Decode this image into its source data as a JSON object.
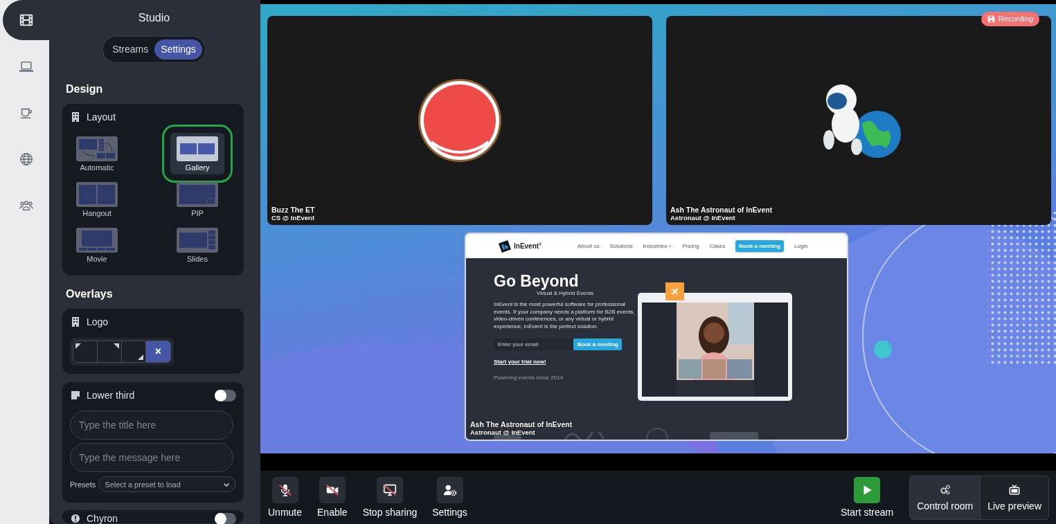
{
  "rail": {
    "items": [
      {
        "kind": "film",
        "selected": true
      },
      {
        "kind": "laptop",
        "selected": false
      },
      {
        "kind": "cup",
        "selected": false
      },
      {
        "kind": "globe",
        "selected": false
      },
      {
        "kind": "people",
        "selected": false
      }
    ]
  },
  "panel": {
    "title": "Studio",
    "tabs": [
      {
        "label": "Streams",
        "selected": false
      },
      {
        "label": "Settings",
        "selected": true
      }
    ],
    "design": {
      "heading": "Design",
      "layout": {
        "title": "Layout",
        "options": [
          {
            "kind": "automatic",
            "label": "Automatic",
            "selected": false
          },
          {
            "kind": "gallery",
            "label": "Gallery",
            "selected": true
          },
          {
            "kind": "hangout",
            "label": "Hangout",
            "selected": false
          },
          {
            "kind": "pip",
            "label": "PIP",
            "selected": false
          },
          {
            "kind": "movie",
            "label": "Movie",
            "selected": false
          },
          {
            "kind": "slides",
            "label": "Slides",
            "selected": false
          }
        ]
      }
    },
    "overlays": {
      "heading": "Overlays",
      "logo": {
        "title": "Logo",
        "positions": [
          {
            "kind": "top-left",
            "selected": false
          },
          {
            "kind": "top-right",
            "selected": false
          },
          {
            "kind": "bottom-right",
            "selected": false
          },
          {
            "kind": "none",
            "label": "×",
            "selected": true
          }
        ]
      },
      "lower_third": {
        "title": "Lower third",
        "on": false,
        "fields": [
          {
            "placeholder": "Type the title here"
          },
          {
            "placeholder": "Type the message here"
          }
        ],
        "presets": {
          "label": "Presets",
          "placeholder": "Select a preset to load"
        }
      },
      "chyron": {
        "title": "Chyron",
        "on": false
      }
    }
  },
  "stage": {
    "recording_badge": "Recording",
    "tiles": [
      {
        "kind": "avatar",
        "name": "Buzz The ET",
        "role": "CS @ InEvent"
      },
      {
        "kind": "astronaut",
        "name": "Ash The Astronaut of InEvent",
        "role": "Astronaut @ InEvent"
      }
    ],
    "screen_share": {
      "name": "Ash The Astronaut of InEvent",
      "role": "Astronaut @ InEvent",
      "page": {
        "brand": "InEvent$^{®}$",
        "nav": [
          {
            "kind": "link",
            "label": "About us"
          },
          {
            "kind": "link",
            "label": "Solutions"
          },
          {
            "kind": "menu",
            "label": "Industries"
          },
          {
            "kind": "link",
            "label": "Pricing"
          },
          {
            "kind": "link",
            "label": "Cases"
          },
          {
            "kind": "button",
            "label": "Book a meeting"
          },
          {
            "kind": "link",
            "label": "Login"
          }
        ],
        "headline": "Go Beyond",
        "tagline": "Virtual & Hybrid Events",
        "intro": "InEvent is the most powerful software for professional events. If your company needs a platform for B2B events, video-driven conferences, or any virtual or hybrid experience, InEvent is the perfect solution.",
        "email_placeholder": "Enter your email",
        "cta": "Book a meeting",
        "trial_link": "Start your trial now!",
        "since": "Powering events since 2014"
      }
    }
  },
  "controls": {
    "buttons": [
      {
        "kind": "mic",
        "label": "Unmute",
        "off": true
      },
      {
        "kind": "camera",
        "label": "Enable",
        "off": true
      },
      {
        "kind": "screen",
        "label": "Stop sharing",
        "off": true
      },
      {
        "kind": "settings",
        "label": "Settings",
        "off": false
      }
    ],
    "start": {
      "label": "Start stream"
    },
    "views": [
      {
        "kind": "control",
        "label": "Control room",
        "selected": true
      },
      {
        "kind": "preview",
        "label": "Live preview",
        "selected": false
      }
    ]
  }
}
